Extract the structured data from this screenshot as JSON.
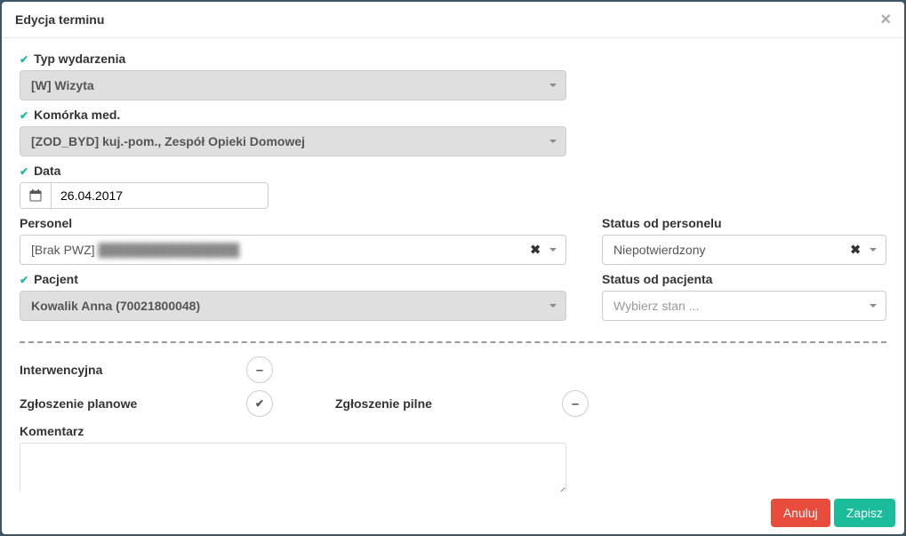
{
  "modal": {
    "title": "Edycja terminu",
    "close_label": "×"
  },
  "fields": {
    "event_type": {
      "label": "Typ wydarzenia",
      "value": "[W]  Wizyta"
    },
    "med_cell": {
      "label": "Komórka med.",
      "value": "[ZOD_BYD]   kuj.-pom., Zespół Opieki Domowej"
    },
    "date": {
      "label": "Data",
      "value": "26.04.2017"
    },
    "personnel": {
      "label": "Personel",
      "prefix": "[Brak PWZ]",
      "value_blurred": "████████████████"
    },
    "patient": {
      "label": "Pacjent",
      "value": "Kowalik Anna (70021800048)"
    },
    "status_personnel": {
      "label": "Status od personelu",
      "value": "Niepotwierdzony"
    },
    "status_patient": {
      "label": "Status od pacjenta",
      "placeholder": "Wybierz stan ..."
    }
  },
  "flags": {
    "intervention_label": "Interwencyjna",
    "planned_label": "Zgłoszenie planowe",
    "urgent_label": "Zgłoszenie pilne",
    "comment_label": "Komentarz"
  },
  "footer": {
    "cancel": "Anuluj",
    "save": "Zapisz"
  }
}
